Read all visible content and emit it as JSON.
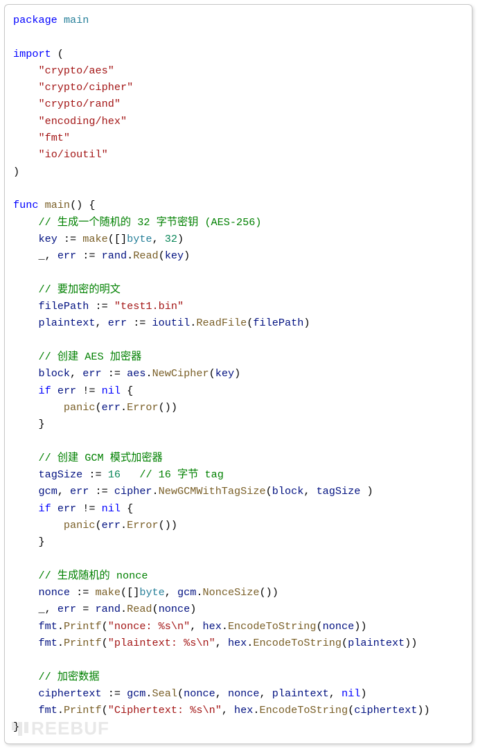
{
  "watermark": "REEBUF",
  "source_lang": "go",
  "tokens": [
    [
      {
        "c": "kw",
        "t": "package"
      },
      {
        "c": "",
        "t": " "
      },
      {
        "c": "pkg",
        "t": "main"
      }
    ],
    [],
    [
      {
        "c": "kw",
        "t": "import"
      },
      {
        "c": "",
        "t": " ("
      }
    ],
    [
      {
        "c": "",
        "t": "    "
      },
      {
        "c": "imp",
        "t": "\"crypto/aes\""
      }
    ],
    [
      {
        "c": "",
        "t": "    "
      },
      {
        "c": "imp",
        "t": "\"crypto/cipher\""
      }
    ],
    [
      {
        "c": "",
        "t": "    "
      },
      {
        "c": "imp",
        "t": "\"crypto/rand\""
      }
    ],
    [
      {
        "c": "",
        "t": "    "
      },
      {
        "c": "imp",
        "t": "\"encoding/hex\""
      }
    ],
    [
      {
        "c": "",
        "t": "    "
      },
      {
        "c": "imp",
        "t": "\"fmt\""
      }
    ],
    [
      {
        "c": "",
        "t": "    "
      },
      {
        "c": "imp",
        "t": "\"io/ioutil\""
      }
    ],
    [
      {
        "c": "",
        "t": ")"
      }
    ],
    [],
    [
      {
        "c": "kw",
        "t": "func"
      },
      {
        "c": "",
        "t": " "
      },
      {
        "c": "fn",
        "t": "main"
      },
      {
        "c": "",
        "t": "() {"
      }
    ],
    [
      {
        "c": "",
        "t": "    "
      },
      {
        "c": "cmt",
        "t": "// 生成一个随机的 32 字节密钥 (AES-256)"
      }
    ],
    [
      {
        "c": "",
        "t": "    "
      },
      {
        "c": "id",
        "t": "key"
      },
      {
        "c": "",
        "t": " := "
      },
      {
        "c": "fn",
        "t": "make"
      },
      {
        "c": "",
        "t": "([]"
      },
      {
        "c": "typ",
        "t": "byte"
      },
      {
        "c": "",
        "t": ", "
      },
      {
        "c": "num",
        "t": "32"
      },
      {
        "c": "",
        "t": ")"
      }
    ],
    [
      {
        "c": "",
        "t": "    _, "
      },
      {
        "c": "id",
        "t": "err"
      },
      {
        "c": "",
        "t": " := "
      },
      {
        "c": "id",
        "t": "rand"
      },
      {
        "c": "",
        "t": "."
      },
      {
        "c": "fn",
        "t": "Read"
      },
      {
        "c": "",
        "t": "("
      },
      {
        "c": "id",
        "t": "key"
      },
      {
        "c": "",
        "t": ")"
      }
    ],
    [],
    [
      {
        "c": "",
        "t": "    "
      },
      {
        "c": "cmt",
        "t": "// 要加密的明文"
      }
    ],
    [
      {
        "c": "",
        "t": "    "
      },
      {
        "c": "id",
        "t": "filePath"
      },
      {
        "c": "",
        "t": " := "
      },
      {
        "c": "str",
        "t": "\"test1.bin\""
      }
    ],
    [
      {
        "c": "",
        "t": "    "
      },
      {
        "c": "id",
        "t": "plaintext"
      },
      {
        "c": "",
        "t": ", "
      },
      {
        "c": "id",
        "t": "err"
      },
      {
        "c": "",
        "t": " := "
      },
      {
        "c": "id",
        "t": "ioutil"
      },
      {
        "c": "",
        "t": "."
      },
      {
        "c": "fn",
        "t": "ReadFile"
      },
      {
        "c": "",
        "t": "("
      },
      {
        "c": "id",
        "t": "filePath"
      },
      {
        "c": "",
        "t": ")"
      }
    ],
    [],
    [
      {
        "c": "",
        "t": "    "
      },
      {
        "c": "cmt",
        "t": "// 创建 AES 加密器"
      }
    ],
    [
      {
        "c": "",
        "t": "    "
      },
      {
        "c": "id",
        "t": "block"
      },
      {
        "c": "",
        "t": ", "
      },
      {
        "c": "id",
        "t": "err"
      },
      {
        "c": "",
        "t": " := "
      },
      {
        "c": "id",
        "t": "aes"
      },
      {
        "c": "",
        "t": "."
      },
      {
        "c": "fn",
        "t": "NewCipher"
      },
      {
        "c": "",
        "t": "("
      },
      {
        "c": "id",
        "t": "key"
      },
      {
        "c": "",
        "t": ")"
      }
    ],
    [
      {
        "c": "",
        "t": "    "
      },
      {
        "c": "kw",
        "t": "if"
      },
      {
        "c": "",
        "t": " "
      },
      {
        "c": "id",
        "t": "err"
      },
      {
        "c": "",
        "t": " != "
      },
      {
        "c": "const",
        "t": "nil"
      },
      {
        "c": "",
        "t": " {"
      }
    ],
    [
      {
        "c": "",
        "t": "        "
      },
      {
        "c": "fn",
        "t": "panic"
      },
      {
        "c": "",
        "t": "("
      },
      {
        "c": "id",
        "t": "err"
      },
      {
        "c": "",
        "t": "."
      },
      {
        "c": "fn",
        "t": "Error"
      },
      {
        "c": "",
        "t": "())"
      }
    ],
    [
      {
        "c": "",
        "t": "    }"
      }
    ],
    [],
    [
      {
        "c": "",
        "t": "    "
      },
      {
        "c": "cmt",
        "t": "// 创建 GCM 模式加密器"
      }
    ],
    [
      {
        "c": "",
        "t": "    "
      },
      {
        "c": "id",
        "t": "tagSize"
      },
      {
        "c": "",
        "t": " := "
      },
      {
        "c": "num",
        "t": "16"
      },
      {
        "c": "",
        "t": "   "
      },
      {
        "c": "cmt",
        "t": "// 16 字节 tag"
      }
    ],
    [
      {
        "c": "",
        "t": "    "
      },
      {
        "c": "id",
        "t": "gcm"
      },
      {
        "c": "",
        "t": ", "
      },
      {
        "c": "id",
        "t": "err"
      },
      {
        "c": "",
        "t": " := "
      },
      {
        "c": "id",
        "t": "cipher"
      },
      {
        "c": "",
        "t": "."
      },
      {
        "c": "fn",
        "t": "NewGCMWithTagSize"
      },
      {
        "c": "",
        "t": "("
      },
      {
        "c": "id",
        "t": "block"
      },
      {
        "c": "",
        "t": ", "
      },
      {
        "c": "id",
        "t": "tagSize"
      },
      {
        "c": "",
        "t": " )"
      }
    ],
    [
      {
        "c": "",
        "t": "    "
      },
      {
        "c": "kw",
        "t": "if"
      },
      {
        "c": "",
        "t": " "
      },
      {
        "c": "id",
        "t": "err"
      },
      {
        "c": "",
        "t": " != "
      },
      {
        "c": "const",
        "t": "nil"
      },
      {
        "c": "",
        "t": " {"
      }
    ],
    [
      {
        "c": "",
        "t": "        "
      },
      {
        "c": "fn",
        "t": "panic"
      },
      {
        "c": "",
        "t": "("
      },
      {
        "c": "id",
        "t": "err"
      },
      {
        "c": "",
        "t": "."
      },
      {
        "c": "fn",
        "t": "Error"
      },
      {
        "c": "",
        "t": "())"
      }
    ],
    [
      {
        "c": "",
        "t": "    }"
      }
    ],
    [],
    [
      {
        "c": "",
        "t": "    "
      },
      {
        "c": "cmt",
        "t": "// 生成随机的 nonce"
      }
    ],
    [
      {
        "c": "",
        "t": "    "
      },
      {
        "c": "id",
        "t": "nonce"
      },
      {
        "c": "",
        "t": " := "
      },
      {
        "c": "fn",
        "t": "make"
      },
      {
        "c": "",
        "t": "([]"
      },
      {
        "c": "typ",
        "t": "byte"
      },
      {
        "c": "",
        "t": ", "
      },
      {
        "c": "id",
        "t": "gcm"
      },
      {
        "c": "",
        "t": "."
      },
      {
        "c": "fn",
        "t": "NonceSize"
      },
      {
        "c": "",
        "t": "())"
      }
    ],
    [
      {
        "c": "",
        "t": "    _, "
      },
      {
        "c": "id",
        "t": "err"
      },
      {
        "c": "",
        "t": " = "
      },
      {
        "c": "id",
        "t": "rand"
      },
      {
        "c": "",
        "t": "."
      },
      {
        "c": "fn",
        "t": "Read"
      },
      {
        "c": "",
        "t": "("
      },
      {
        "c": "id",
        "t": "nonce"
      },
      {
        "c": "",
        "t": ")"
      }
    ],
    [
      {
        "c": "",
        "t": "    "
      },
      {
        "c": "id",
        "t": "fmt"
      },
      {
        "c": "",
        "t": "."
      },
      {
        "c": "fn",
        "t": "Printf"
      },
      {
        "c": "",
        "t": "("
      },
      {
        "c": "str",
        "t": "\"nonce: %s\\n\""
      },
      {
        "c": "",
        "t": ", "
      },
      {
        "c": "id",
        "t": "hex"
      },
      {
        "c": "",
        "t": "."
      },
      {
        "c": "fn",
        "t": "EncodeToString"
      },
      {
        "c": "",
        "t": "("
      },
      {
        "c": "id",
        "t": "nonce"
      },
      {
        "c": "",
        "t": "))"
      }
    ],
    [
      {
        "c": "",
        "t": "    "
      },
      {
        "c": "id",
        "t": "fmt"
      },
      {
        "c": "",
        "t": "."
      },
      {
        "c": "fn",
        "t": "Printf"
      },
      {
        "c": "",
        "t": "("
      },
      {
        "c": "str",
        "t": "\"plaintext: %s\\n\""
      },
      {
        "c": "",
        "t": ", "
      },
      {
        "c": "id",
        "t": "hex"
      },
      {
        "c": "",
        "t": "."
      },
      {
        "c": "fn",
        "t": "EncodeToString"
      },
      {
        "c": "",
        "t": "("
      },
      {
        "c": "id",
        "t": "plaintext"
      },
      {
        "c": "",
        "t": "))"
      }
    ],
    [],
    [
      {
        "c": "",
        "t": "    "
      },
      {
        "c": "cmt",
        "t": "// 加密数据"
      }
    ],
    [
      {
        "c": "",
        "t": "    "
      },
      {
        "c": "id",
        "t": "ciphertext"
      },
      {
        "c": "",
        "t": " := "
      },
      {
        "c": "id",
        "t": "gcm"
      },
      {
        "c": "",
        "t": "."
      },
      {
        "c": "fn",
        "t": "Seal"
      },
      {
        "c": "",
        "t": "("
      },
      {
        "c": "id",
        "t": "nonce"
      },
      {
        "c": "",
        "t": ", "
      },
      {
        "c": "id",
        "t": "nonce"
      },
      {
        "c": "",
        "t": ", "
      },
      {
        "c": "id",
        "t": "plaintext"
      },
      {
        "c": "",
        "t": ", "
      },
      {
        "c": "const",
        "t": "nil"
      },
      {
        "c": "",
        "t": ")"
      }
    ],
    [
      {
        "c": "",
        "t": "    "
      },
      {
        "c": "id",
        "t": "fmt"
      },
      {
        "c": "",
        "t": "."
      },
      {
        "c": "fn",
        "t": "Printf"
      },
      {
        "c": "",
        "t": "("
      },
      {
        "c": "str",
        "t": "\"Ciphertext: %s\\n\""
      },
      {
        "c": "",
        "t": ", "
      },
      {
        "c": "id",
        "t": "hex"
      },
      {
        "c": "",
        "t": "."
      },
      {
        "c": "fn",
        "t": "EncodeToString"
      },
      {
        "c": "",
        "t": "("
      },
      {
        "c": "id",
        "t": "ciphertext"
      },
      {
        "c": "",
        "t": "))"
      }
    ],
    [
      {
        "c": "",
        "t": "}"
      }
    ]
  ]
}
